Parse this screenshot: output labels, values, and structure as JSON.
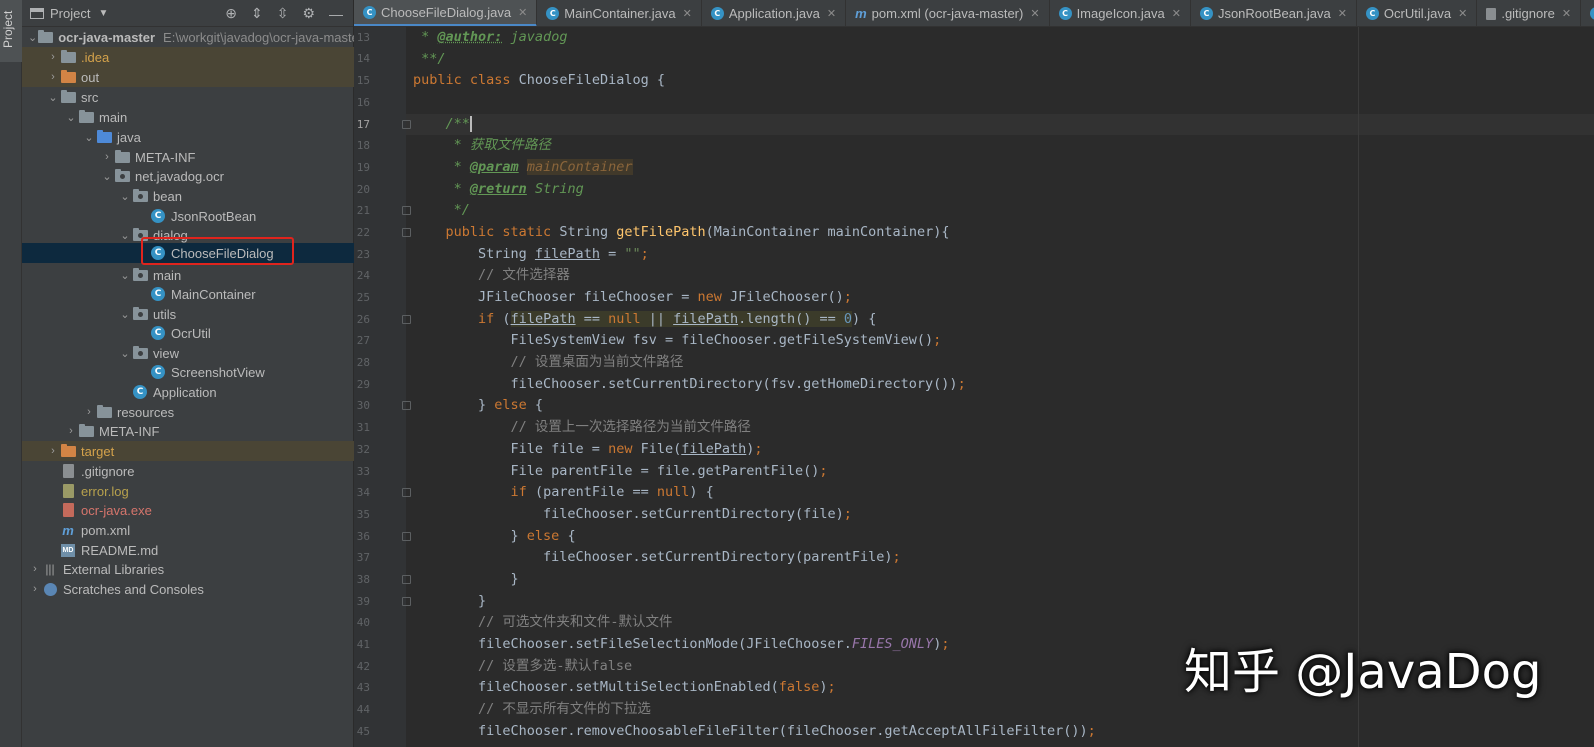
{
  "sidebar_stripe": {
    "label": "Project"
  },
  "panel": {
    "title": "Project",
    "tree": [
      {
        "label": "ocr-java-master",
        "path": "E:\\workgit\\javadog\\ocr-java-master"
      },
      {
        "label": ".idea"
      },
      {
        "label": "out"
      },
      {
        "label": "src"
      },
      {
        "label": "main"
      },
      {
        "label": "java"
      },
      {
        "label": "META-INF"
      },
      {
        "label": "net.javadog.ocr"
      },
      {
        "label": "bean"
      },
      {
        "label": "JsonRootBean"
      },
      {
        "label": "dialog"
      },
      {
        "label": "ChooseFileDialog"
      },
      {
        "label": "main"
      },
      {
        "label": "MainContainer"
      },
      {
        "label": "utils"
      },
      {
        "label": "OcrUtil"
      },
      {
        "label": "view"
      },
      {
        "label": "ScreenshotView"
      },
      {
        "label": "Application"
      },
      {
        "label": "resources"
      },
      {
        "label": "META-INF"
      },
      {
        "label": "target"
      },
      {
        "label": ".gitignore"
      },
      {
        "label": "error.log"
      },
      {
        "label": "ocr-java.exe"
      },
      {
        "label": "pom.xml"
      },
      {
        "label": "README.md"
      },
      {
        "label": "External Libraries"
      },
      {
        "label": "Scratches and Consoles"
      }
    ]
  },
  "tabs": [
    {
      "label": "ChooseFileDialog.java"
    },
    {
      "label": "MainContainer.java"
    },
    {
      "label": "Application.java"
    },
    {
      "label": "pom.xml (ocr-java-master)"
    },
    {
      "label": "ImageIcon.java"
    },
    {
      "label": "JsonRootBean.java"
    },
    {
      "label": "OcrUtil.java"
    },
    {
      "label": ".gitignore"
    },
    {
      "label": "S"
    }
  ],
  "line_numbers": [
    "13",
    "14",
    "15",
    "16",
    "17",
    "18",
    "19",
    "20",
    "21",
    "22",
    "23",
    "24",
    "25",
    "26",
    "27",
    "28",
    "29",
    "30",
    "31",
    "32",
    "33",
    "34",
    "35",
    "36",
    "37",
    "38",
    "39",
    "40",
    "41",
    "42",
    "43",
    "44",
    "45"
  ],
  "code": {
    "l13_star": " * ",
    "l13_tag": "@author:",
    "l13_rest": " javadog",
    "l14": " **/",
    "l15_kw": "public class",
    "l15_rest": " ChooseFileDialog {",
    "l17": "    /**",
    "l18": "     * 获取文件路径",
    "l19_star": "     * ",
    "l19_tag": "@param",
    "l19_sp": " ",
    "l19_ref": "mainContainer",
    "l20_star": "     * ",
    "l20_tag": "@return",
    "l20_rest": " String",
    "l21": "     */",
    "l22_ind": "    ",
    "l22_kw": "public static",
    "l22_t": " String ",
    "l22_fn": "getFilePath",
    "l22_rest": "(MainContainer mainContainer){",
    "l23_a": "        String ",
    "l23_var": "filePath",
    "l23_b": " = ",
    "l23_str": "\"\"",
    "l23_semi": ";",
    "l24": "        // 文件选择器",
    "l25_a": "        JFileChooser fileChooser = ",
    "l25_kw": "new",
    "l25_b": " JFileChooser()",
    "l25_semi": ";",
    "l26_ind": "        ",
    "l26_kw": "if",
    "l26_a": " (",
    "l26_v1": "filePath",
    "l26_b": " == ",
    "l26_null": "null",
    "l26_or": " || ",
    "l26_v2": "filePath",
    "l26_c": ".length() == ",
    "l26_zero": "0",
    "l26_d": ") {",
    "l27_a": "            FileSystemView fsv = fileChooser.getFileSystemView()",
    "l27_semi": ";",
    "l28": "            // 设置桌面为当前文件路径",
    "l29_a": "            fileChooser.setCurrentDirectory(fsv.getHomeDirectory())",
    "l29_semi": ";",
    "l30_a": "        } ",
    "l30_kw": "else",
    "l30_b": " {",
    "l31": "            // 设置上一次选择路径为当前文件路径",
    "l32_a": "            File file = ",
    "l32_kw": "new",
    "l32_b": " File(",
    "l32_var": "filePath",
    "l32_c": ")",
    "l32_semi": ";",
    "l33_a": "            File parentFile = file.getParentFile()",
    "l33_semi": ";",
    "l34_ind": "            ",
    "l34_kw": "if",
    "l34_a": " (parentFile == ",
    "l34_null": "null",
    "l34_b": ") {",
    "l35_a": "                fileChooser.setCurrentDirectory(file)",
    "l35_semi": ";",
    "l36_a": "            } ",
    "l36_kw": "else",
    "l36_b": " {",
    "l37_a": "                fileChooser.setCurrentDirectory(parentFile)",
    "l37_semi": ";",
    "l38": "            }",
    "l39": "        }",
    "l40": "        // 可选文件夹和文件-默认文件",
    "l41_a": "        fileChooser.setFileSelectionMode(JFileChooser.",
    "l41_const": "FILES_ONLY",
    "l41_b": ")",
    "l41_semi": ";",
    "l42": "        // 设置多选-默认false",
    "l43_a": "        fileChooser.setMultiSelectionEnabled(",
    "l43_kw": "false",
    "l43_b": ")",
    "l43_semi": ";",
    "l44": "        // 不显示所有文件的下拉选",
    "l45_a": "        fileChooser.removeChoosableFileFilter(fileChooser.getAcceptAllFileFilter())",
    "l45_semi": ";"
  },
  "watermark": "知乎 @JavaDog"
}
